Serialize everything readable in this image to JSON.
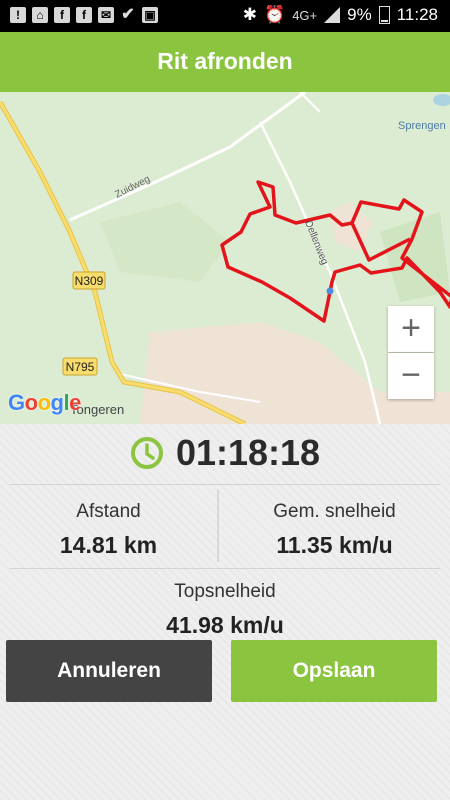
{
  "status_bar": {
    "battery": "9%",
    "time": "11:28",
    "network": "4G+"
  },
  "header": {
    "title": "Rit afronden"
  },
  "map": {
    "labels": {
      "zuidweg": "Zuidweg",
      "dellenweg": "Dellenweg",
      "sprengen": "Sprengen",
      "tongeren": "Tongeren",
      "n309": "N309",
      "n795": "N795"
    },
    "google_logo": "Google",
    "zoom_in": "+",
    "zoom_out": "−",
    "route_color": "#e4141b"
  },
  "stats": {
    "duration": "01:18:18",
    "distance_label": "Afstand",
    "distance_value": "14.81 km",
    "avg_speed_label": "Gem. snelheid",
    "avg_speed_value": "11.35 km/u",
    "top_speed_label": "Topsnelheid",
    "top_speed_value": "41.98 km/u"
  },
  "actions": {
    "cancel_label": "Annuleren",
    "save_label": "Opslaan"
  },
  "colors": {
    "accent": "#8bc43f",
    "cancel": "#444444"
  }
}
